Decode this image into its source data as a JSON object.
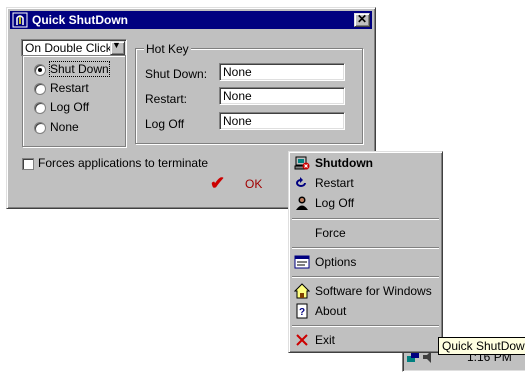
{
  "dialog": {
    "title": "Quick ShutDown",
    "close_glyph": "✕",
    "trigger_select": {
      "value": "On Double Click:"
    },
    "action_options": [
      "Shut Down",
      "Restart",
      "Log Off",
      "None"
    ],
    "selected_action": "Shut Down",
    "hotkey": {
      "legend": "Hot Key",
      "rows": [
        {
          "label": "Shut Down:",
          "value": "None"
        },
        {
          "label": "Restart:",
          "value": "None"
        },
        {
          "label": "Log Off",
          "value": "None"
        }
      ]
    },
    "force_checkbox": {
      "label": "Forces applications to terminate",
      "checked": false
    },
    "ok_label": "OK"
  },
  "context_menu": {
    "items": [
      {
        "label": "Shutdown",
        "icon": "shutdown-icon",
        "bold": true
      },
      {
        "label": "Restart",
        "icon": "restart-icon"
      },
      {
        "label": "Log Off",
        "icon": "logoff-icon"
      },
      {
        "label": "Force",
        "icon": ""
      },
      {
        "label": "Options",
        "icon": "options-icon"
      },
      {
        "label": "Software for Windows",
        "icon": "home-icon"
      },
      {
        "label": "About",
        "icon": "help-icon"
      },
      {
        "label": "Exit",
        "icon": "exit-icon"
      }
    ]
  },
  "tray": {
    "tooltip": "Quick ShutDown",
    "time": "1:16 PM"
  },
  "colors": {
    "titlebar": "#000080",
    "face": "#c0c0c0",
    "ok_check": "#cc0000",
    "tooltip_bg": "#ffffe1"
  }
}
